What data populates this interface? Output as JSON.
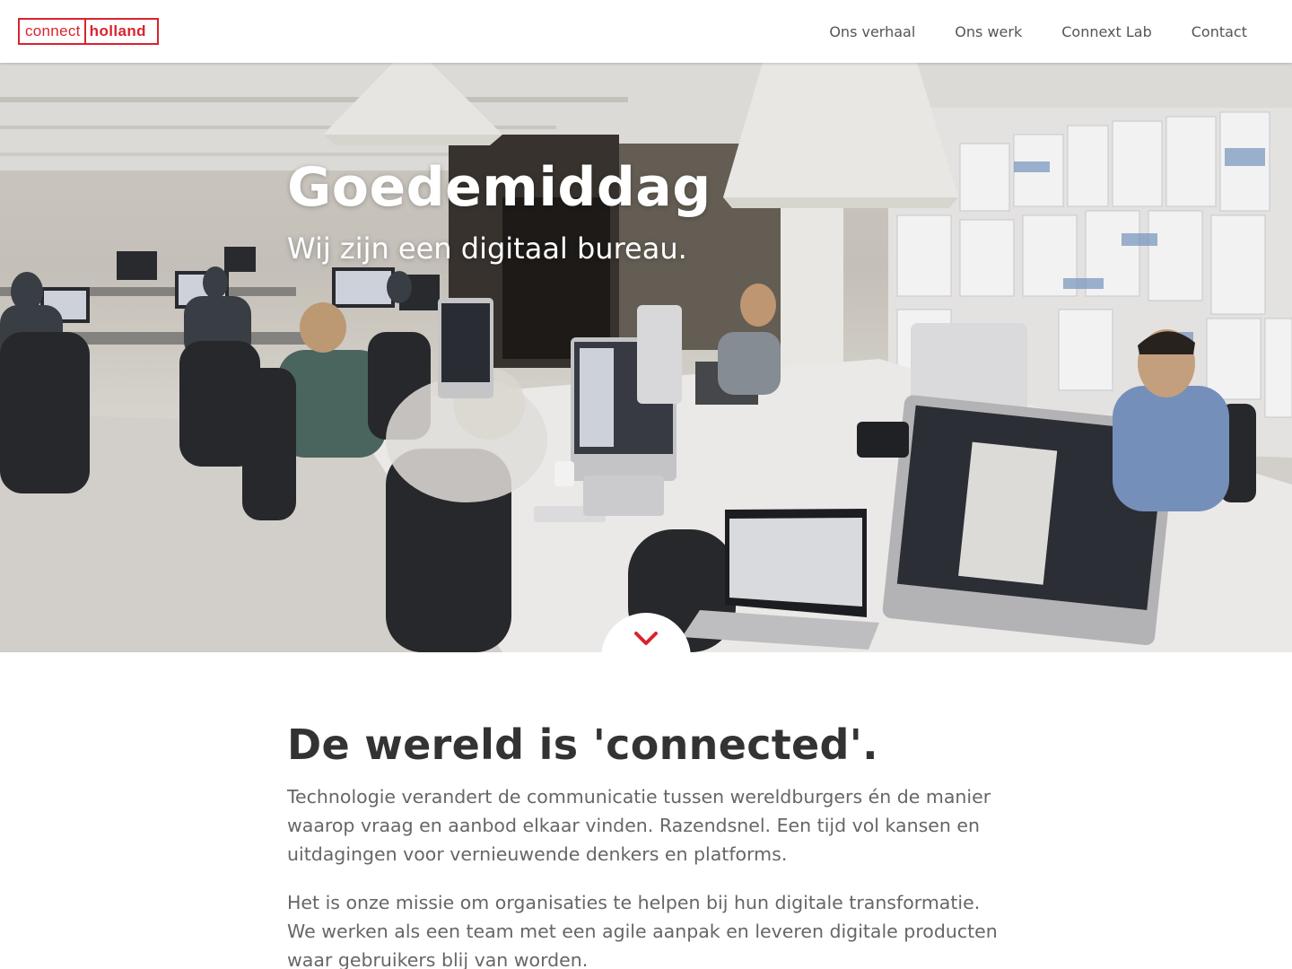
{
  "header": {
    "logo": {
      "part1": "connect",
      "part2": "holland"
    },
    "nav": [
      {
        "label": "Ons verhaal"
      },
      {
        "label": "Ons werk"
      },
      {
        "label": "Connext Lab"
      },
      {
        "label": "Contact"
      }
    ]
  },
  "hero": {
    "title": "Goedemiddag",
    "subtitle": "Wij zijn een digitaal bureau.",
    "scroll_icon": "chevron-down-icon",
    "image": "office-workspace-photo"
  },
  "intro": {
    "heading": "De wereld is 'connected'.",
    "paragraphs": [
      "Technologie verandert de communicatie tussen wereldburgers én de manier waarop vraag en aanbod elkaar vinden. Razendsnel. Een tijd vol kansen en uitdagingen voor vernieuwende denkers en platforms.",
      "Het is onze missie om organisaties te helpen bij hun digitale transformatie. We werken als een team met een agile aanpak en leveren digitale producten waar gebruikers blij van worden."
    ]
  },
  "colors": {
    "brand_red": "#d8242e",
    "text_dark": "#333333",
    "text_muted": "#666666"
  }
}
